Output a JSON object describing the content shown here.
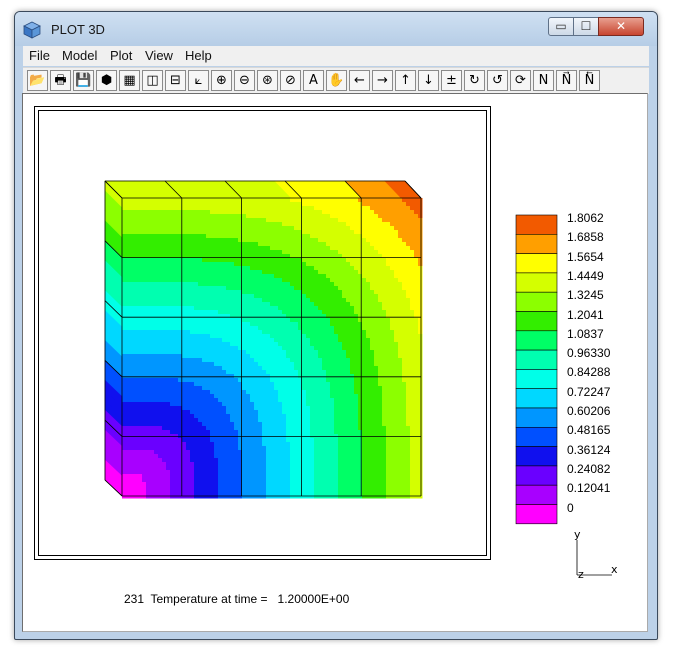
{
  "window": {
    "title": "PLOT 3D",
    "minimize": "▭",
    "maximize": "☐",
    "close": "✕"
  },
  "menu": [
    "File",
    "Model",
    "Plot",
    "View",
    "Help"
  ],
  "toolbar": [
    {
      "name": "open-icon",
      "glyph": "📂"
    },
    {
      "name": "print-icon",
      "glyph": "🖶"
    },
    {
      "name": "save-icon",
      "glyph": "💾"
    },
    {
      "name": "cube-icon",
      "glyph": "⬢"
    },
    {
      "name": "grid-icon",
      "glyph": "▦"
    },
    {
      "name": "vertical-split-icon",
      "glyph": "◫"
    },
    {
      "name": "horizontal-split-icon",
      "glyph": "⊟"
    },
    {
      "name": "axes-icon",
      "glyph": "⟀"
    },
    {
      "name": "zoom-in-icon",
      "glyph": "⊕"
    },
    {
      "name": "zoom-out-icon",
      "glyph": "⊖"
    },
    {
      "name": "zoom-fit-icon",
      "glyph": "⊛"
    },
    {
      "name": "zoom-previous-icon",
      "glyph": "⊘"
    },
    {
      "name": "text-icon",
      "glyph": "A"
    },
    {
      "name": "pan-hand-icon",
      "glyph": "✋"
    },
    {
      "name": "arrow-left-icon",
      "glyph": "←"
    },
    {
      "name": "arrow-right-icon",
      "glyph": "→"
    },
    {
      "name": "arrow-up-icon",
      "glyph": "↑"
    },
    {
      "name": "arrow-down-icon",
      "glyph": "↓"
    },
    {
      "name": "plus-minus-icon",
      "glyph": "±"
    },
    {
      "name": "rotate-x-icon",
      "glyph": "↻"
    },
    {
      "name": "rotate-y-icon",
      "glyph": "↺"
    },
    {
      "name": "rotate-z-icon",
      "glyph": "⟳"
    },
    {
      "name": "normal-icon",
      "glyph": "N"
    },
    {
      "name": "normal-next-icon",
      "glyph": "N⃗"
    },
    {
      "name": "normal-previous-icon",
      "glyph": "N⃖"
    }
  ],
  "legend": {
    "labels": [
      "1.8062",
      "1.6858",
      "1.5654",
      "1.4449",
      "1.3245",
      "1.2041",
      "1.0837",
      "0.96330",
      "0.84288",
      "0.72247",
      "0.60206",
      "0.48165",
      "0.36124",
      "0.24082",
      "0.12041",
      "0"
    ],
    "colors": [
      "#f25a00",
      "#ff9f00",
      "#ffff00",
      "#d4ff00",
      "#8cff00",
      "#33ee00",
      "#00ff66",
      "#00ffb0",
      "#00ffe8",
      "#00d8ff",
      "#0096ff",
      "#0050ff",
      "#1010ee",
      "#6a00ff",
      "#a800ff",
      "#ff00ff"
    ]
  },
  "axes": {
    "y": "y",
    "z": "z",
    "x": "x"
  },
  "status": "231  Temperature at time =   1.20000E+00"
}
